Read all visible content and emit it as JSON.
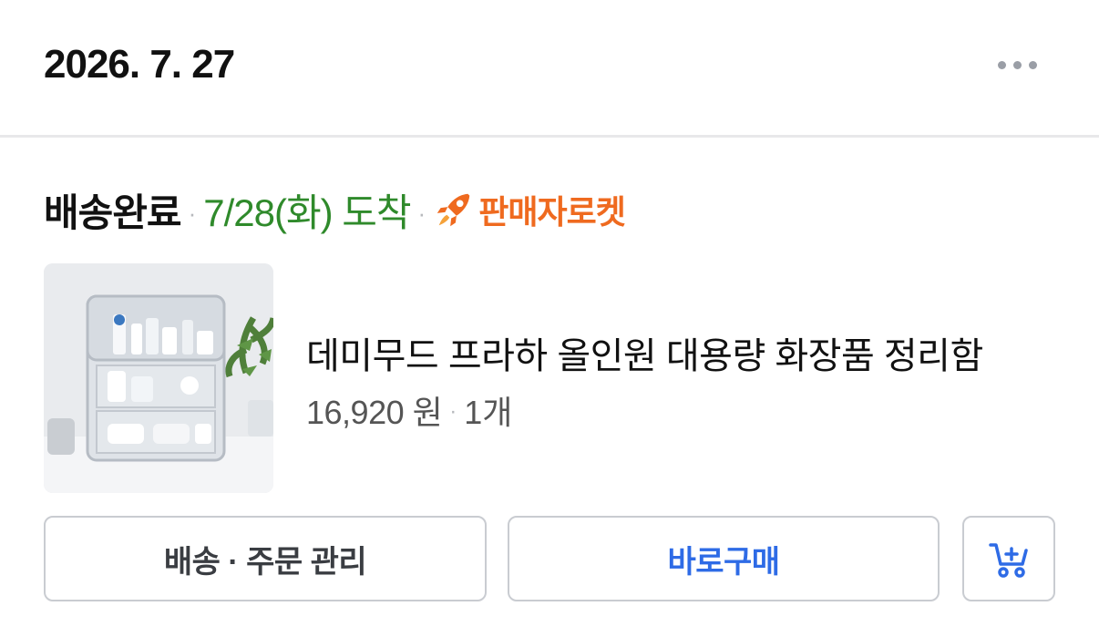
{
  "header": {
    "date": "2026. 7. 27",
    "more_icon": "more-horizontal-icon"
  },
  "shipment": {
    "status": "배송완료",
    "separator": "·",
    "arrival": "7/28(화) 도착",
    "badge_icon": "rocket-icon",
    "badge_label": "판매자로켓",
    "colors": {
      "arrival": "#2f8a2b",
      "badge": "#ef6a1f"
    }
  },
  "product": {
    "image_icon": "product-thumbnail",
    "name": "데미무드 프라하 올인원 대용량 화장품 정리함",
    "price": "16,920 원",
    "separator": "·",
    "quantity": "1개"
  },
  "actions": {
    "manage_label": "배송 · 주문 관리",
    "buy_label": "바로구매",
    "cart_icon": "add-to-cart-icon",
    "colors": {
      "buy": "#2e6be6"
    }
  }
}
